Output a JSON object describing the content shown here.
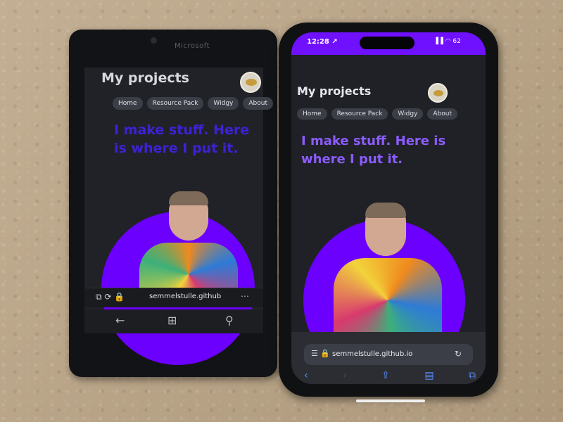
{
  "lumia": {
    "brand": "Microsoft",
    "title": "My projects",
    "nav": [
      "Home",
      "Resource Pack",
      "Widgy",
      "About"
    ],
    "headline": "I make stuff. Here is where I put it.",
    "url": "semmelstulle.github",
    "url_icons": "⧉ ⟳ 🔒",
    "nav_buttons": {
      "back": "←",
      "home": "⊞",
      "search": "⚲",
      "more": "⋯"
    },
    "colors": {
      "headline": "#3d21d6",
      "disc": "#6c00ff",
      "background": "#202228"
    }
  },
  "iphone": {
    "time": "12:28 ↗",
    "status_icons": "▐▐ ◠ 62",
    "title": "My projects",
    "nav": [
      "Home",
      "Resource Pack",
      "Widgy",
      "About"
    ],
    "headline": "I make stuff. Here is where I put it.",
    "url": "semmelstulle.github.io",
    "url_icon_left": "☰ 🔒",
    "url_icon_right": "↻",
    "toolbar": [
      "‹",
      "›",
      "⇪",
      "▤",
      "⧉"
    ],
    "colors": {
      "headline": "#8c5cff",
      "statusbar": "#6f10ff",
      "disc": "#6c00ff"
    }
  }
}
